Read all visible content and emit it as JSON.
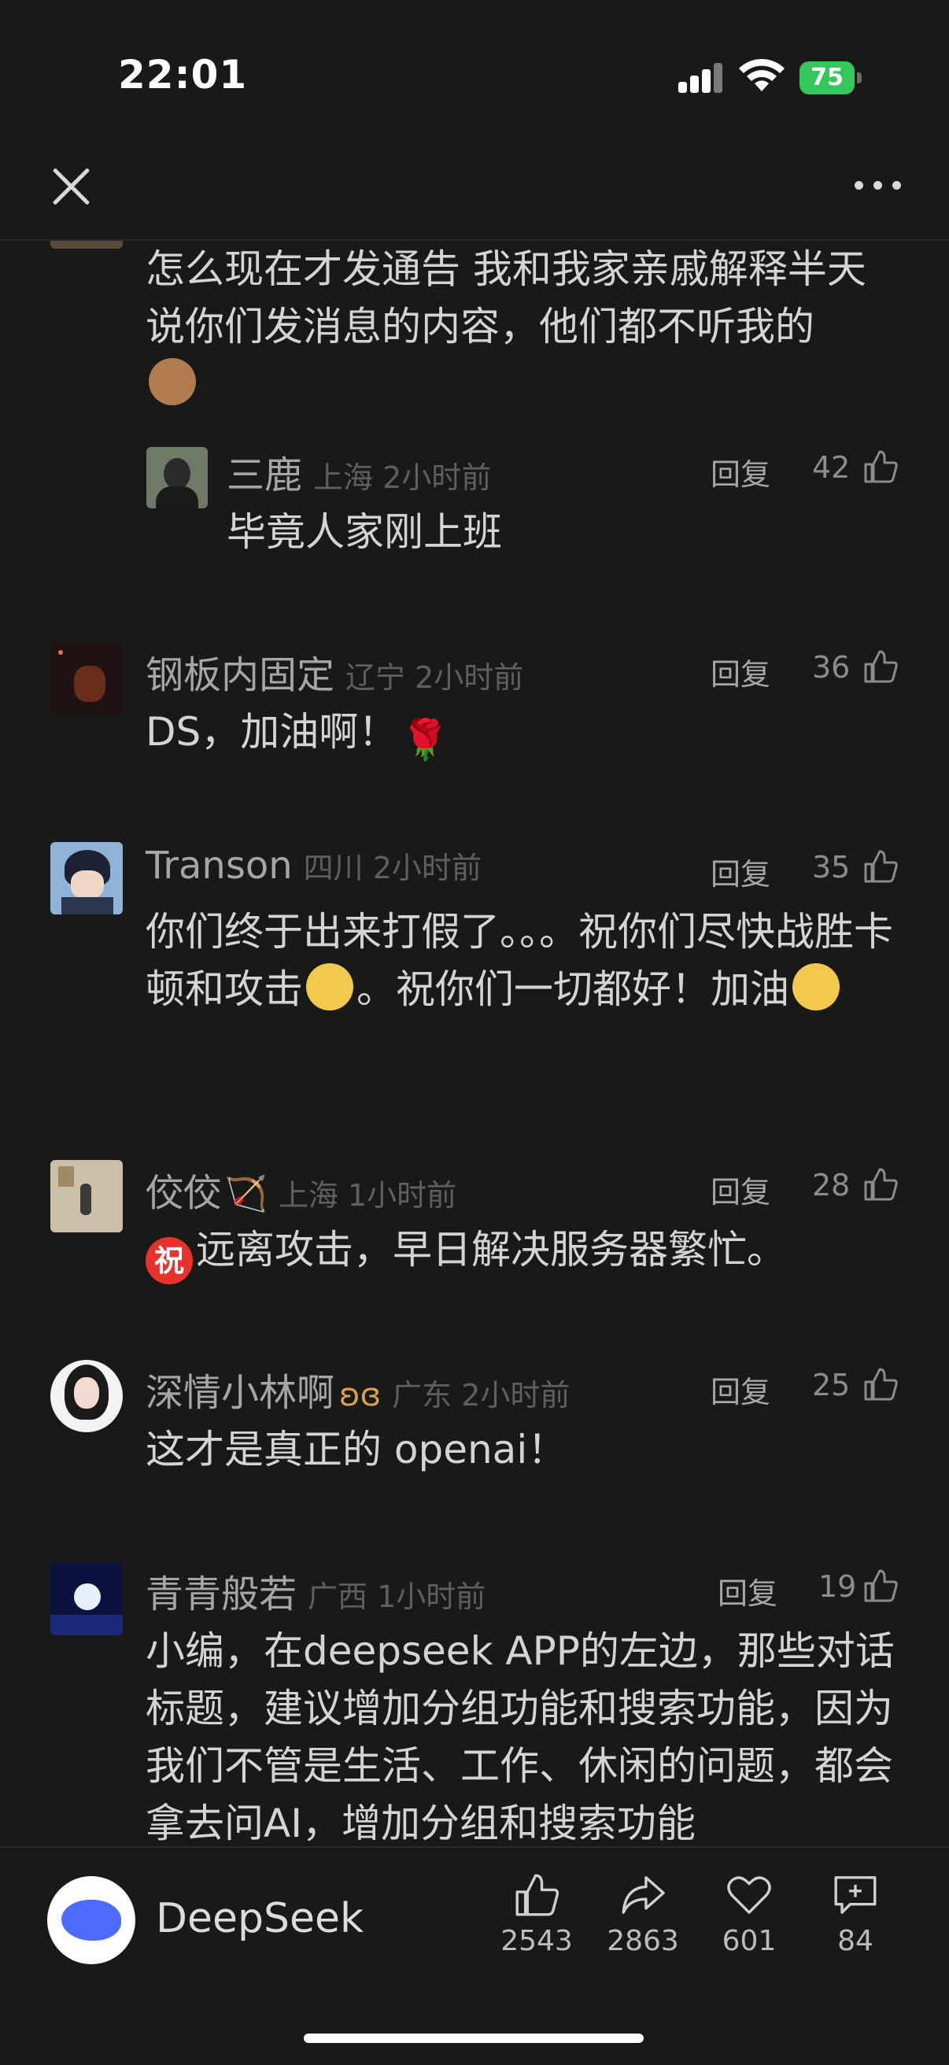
{
  "status": {
    "time": "22:01",
    "battery": "75"
  },
  "comments": [
    {
      "text": "怎么现在才发通告 我和我家亲戚解释半天说你们发消息的内容，他们都不听我的"
    },
    {
      "name": "三鹿",
      "loc": "上海 2小时前",
      "reply": "回复",
      "likes": "42",
      "text": "毕竟人家刚上班"
    },
    {
      "name": "钢板内固定",
      "loc": "辽宁 2小时前",
      "reply": "回复",
      "likes": "36",
      "text": "DS，加油啊！"
    },
    {
      "name": "Transon",
      "loc": "四川 2小时前",
      "reply": "回复",
      "likes": "35",
      "text_a": "你们终于出来打假了。。。祝你们尽快战胜卡顿和攻击",
      "text_b": "。祝你们一切都好！加油"
    },
    {
      "name": "佼佼",
      "loc": "上海 1小时前",
      "reply": "回复",
      "likes": "28",
      "badge": "祝",
      "text": "远离攻击，早日解决服务器繁忙。"
    },
    {
      "name": "深情小林啊",
      "loc": "广东 2小时前",
      "reply": "回复",
      "likes": "25",
      "text": "这才是真正的 openai！"
    },
    {
      "name": "青青般若",
      "loc": "广西 1小时前",
      "reply": "回复",
      "likes": "19",
      "text": "小编，在deepseek APP的左边，那些对话标题，建议增加分组功能和搜索功能，因为我们不管是生活、工作、休闲的问题，都会拿去问AI，增加分组和搜索功能"
    }
  ],
  "bottom": {
    "brand": "DeepSeek",
    "like_count": "2543",
    "share_count": "2863",
    "fav_count": "601",
    "comment_count": "84"
  }
}
